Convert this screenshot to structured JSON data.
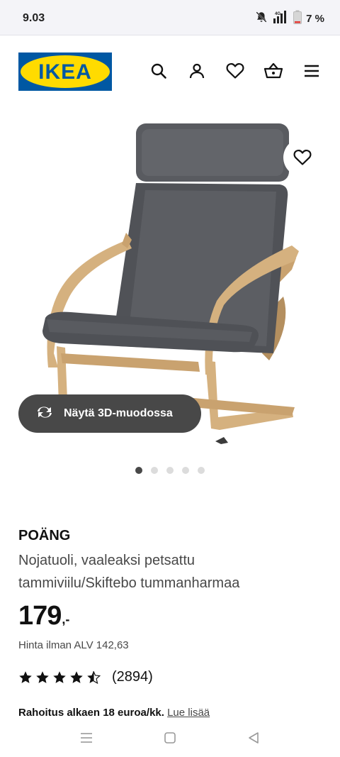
{
  "status_bar": {
    "time": "9.03",
    "network": "4G",
    "battery": "7 %"
  },
  "header": {
    "logo_text": "IKEA",
    "colors": {
      "logo_blue": "#0058a3",
      "logo_yellow": "#ffdb00"
    },
    "icons": [
      "search-icon",
      "account-icon",
      "heart-icon",
      "cart-icon",
      "menu-icon"
    ]
  },
  "hero": {
    "view_3d_label": "Näytä 3D-muodossa",
    "carousel": {
      "total": 5,
      "active": 1
    }
  },
  "product": {
    "name": "POÄNG",
    "description": "Nojatuoli, vaaleaksi petsattu tammiviilu/Skiftebo tummanharmaa",
    "price": "179",
    "price_suffix": ",-",
    "vat_text": "Hinta ilman ALV 142,63",
    "rating_value": 4.5,
    "rating_max": 5,
    "reviews_count": "(2894)",
    "finance_text": "Rahoitus alkaen 18 euroa/kk.",
    "finance_link": "Lue lisää"
  },
  "nav": {
    "icons": [
      "recent-apps-icon",
      "home-icon",
      "back-icon"
    ]
  }
}
